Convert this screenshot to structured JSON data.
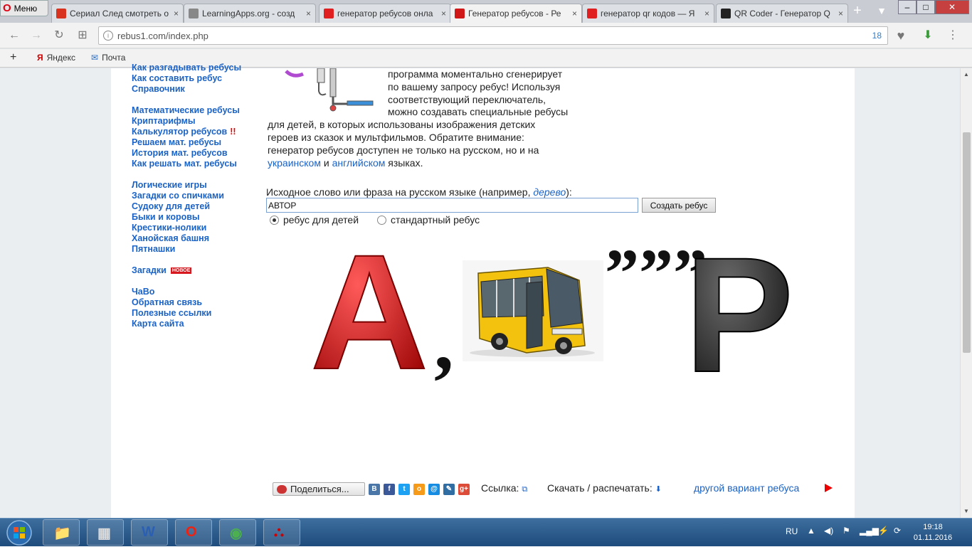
{
  "browser": {
    "menu_label": "Меню",
    "tabs": [
      {
        "title": "Сериал След смотреть о",
        "icon": "bc-icon",
        "color": "#d7331f",
        "active": false
      },
      {
        "title": "LearningApps.org - созд",
        "icon": "doc-icon",
        "color": "#888888",
        "active": false
      },
      {
        "title": "генератор ребусов онла",
        "icon": "yandex-icon",
        "color": "#e02020",
        "active": false
      },
      {
        "title": "Генератор ребусов - Ре",
        "icon": "ball-icon",
        "color": "#d01818",
        "active": true
      },
      {
        "title": "генератор qr кодов — Я",
        "icon": "yandex-icon",
        "color": "#e02020",
        "active": false
      },
      {
        "title": "QR Coder - Генератор Q",
        "icon": "qr-icon",
        "color": "#222222",
        "active": false
      }
    ],
    "url": "rebus1.com/index.php",
    "url_badge": "18",
    "bookmarks": [
      {
        "label": "Яндекс",
        "icon": "yandex-bookmark-icon"
      },
      {
        "label": "Почта",
        "icon": "mail-icon"
      }
    ]
  },
  "sidebar": {
    "groups": [
      [
        "Как разгадывать ребусы",
        "Как составить ребус",
        "Справочник"
      ],
      [
        "Математические ребусы",
        "Криптарифмы",
        "Калькулятор ребусов",
        "Решаем мат. ребусы",
        "История мат. ребусов",
        "Как решать мат. ребусы"
      ],
      [
        "Логические игры",
        "Загадки со спичками",
        "Судоку для детей",
        "Быки и коровы",
        "Крестики-нолики",
        "Ханойская башня",
        "Пятнашки"
      ],
      [
        "Загадки"
      ],
      [
        "ЧаВо",
        "Обратная связь",
        "Полезные ссылки",
        "Карта сайта"
      ]
    ],
    "excl_mark": "!!",
    "new_badge": "НОВОЕ"
  },
  "content": {
    "intro_lines": [
      "программа моментально сгенерирует",
      "по вашему запросу ребус! Используя",
      "соответствующий переключатель,",
      "можно создавать специальные ребусы"
    ],
    "intro_full_1": "для детей, в которых использованы изображения детских",
    "intro_full_2": "героев из сказок и мультфильмов. Обратите внимание:",
    "intro_full_3": "генератор ребусов доступен не только на русском, но и на",
    "link_ukr": "украинском",
    "and": "и",
    "link_eng": "английском",
    "languages_tail": "языках.",
    "form_label_prefix": "Исходное слово или фраза на русском языке (например, ",
    "form_label_example": "дерево",
    "form_label_suffix": "):",
    "input_value": "АВТОР",
    "create_button": "Создать ребус",
    "radio_kids": "ребус для детей",
    "radio_standard": "стандартный ребус",
    "radio_selected": "kids"
  },
  "rebus": {
    "letter_a": "А",
    "comma": ",",
    "quotes": "”””",
    "letter_r": "Р",
    "letter_a_color": "#cc1414",
    "letter_r_color": "#2a2a2a"
  },
  "sharebar": {
    "share_label": "Поделиться...",
    "socials": [
      {
        "name": "vk-icon",
        "glyph": "В",
        "color": "#4a76a8"
      },
      {
        "name": "facebook-icon",
        "glyph": "f",
        "color": "#3b5998"
      },
      {
        "name": "twitter-icon",
        "glyph": "t",
        "color": "#1da1f2"
      },
      {
        "name": "odnoklassniki-icon",
        "glyph": "о",
        "color": "#f59a19"
      },
      {
        "name": "mailru-icon",
        "glyph": "@",
        "color": "#168de2"
      },
      {
        "name": "livejournal-icon",
        "glyph": "✎",
        "color": "#2f6da3"
      },
      {
        "name": "googleplus-icon",
        "glyph": "g+",
        "color": "#dd4b39"
      }
    ],
    "link_label": "Ссылка:",
    "download_label": "Скачать / распечатать:",
    "other_variant": "другой вариант ребуса"
  },
  "taskbar": {
    "apps": [
      "explorer-icon",
      "calculator-icon",
      "word-icon",
      "opera-icon",
      "chrome-icon",
      "acrobat-icon"
    ],
    "lang": "RU",
    "time": "19:18",
    "date": "01.11.2016"
  }
}
